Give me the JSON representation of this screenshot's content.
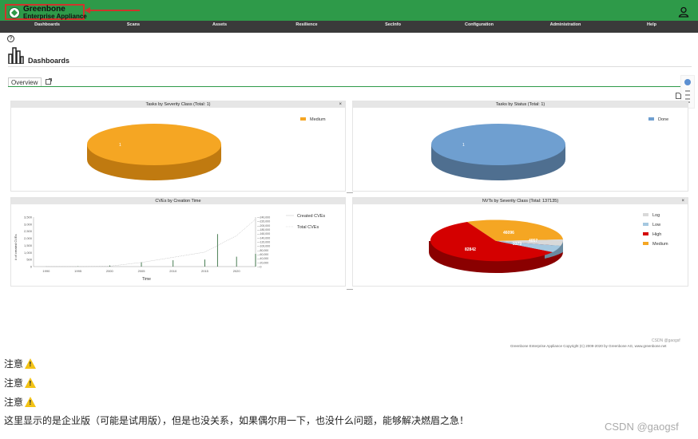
{
  "header": {
    "logo_line1": "Greenbone",
    "logo_line2": "Enterprise Appliance",
    "user_icon": "user-icon",
    "colors": {
      "bar": "#2e9a49",
      "annotation": "#d0342c"
    }
  },
  "nav": {
    "items": [
      "Dashboards",
      "Scans",
      "Assets",
      "Resilience",
      "SecInfo",
      "Configuration",
      "Administration",
      "Help"
    ]
  },
  "page": {
    "title": "Dashboards",
    "tabs": [
      {
        "label": "Overview"
      }
    ]
  },
  "panels": {
    "tasks_severity": {
      "title": "Tasks by Severity Class (Total: 1)",
      "legend": [
        "Medium"
      ],
      "slice_label": "1",
      "color": "#f5a623"
    },
    "tasks_status": {
      "title": "Tasks by Status (Total: 1)",
      "legend": [
        "Done"
      ],
      "slice_label": "1",
      "color": "#6f9fd0"
    },
    "cves": {
      "title": "CVEs by Creation Time",
      "legend": [
        "Created CVEs",
        "Total CVEs"
      ],
      "xlabel": "Time",
      "ylabel": "# of created CVEs",
      "x_ticks": [
        "1990",
        "1995",
        "2000",
        "2005",
        "2010",
        "2015",
        "2020"
      ],
      "y_ticks": [
        "0",
        "500",
        "1,000",
        "1,500",
        "2,000",
        "2,500",
        "3,000",
        "3,500"
      ],
      "y2_ticks": [
        "0",
        "20,000",
        "40,000",
        "60,000",
        "80,000",
        "100,000",
        "120,000",
        "140,000",
        "160,000",
        "180,000",
        "200,000",
        "220,000",
        "240,000"
      ]
    },
    "nvts": {
      "title": "NVTs by Severity Class (Total: 137135)",
      "legend": [
        "Log",
        "Low",
        "High",
        "Medium"
      ],
      "labels": [
        "46096",
        "82842",
        "4057",
        "3379"
      ]
    }
  },
  "footer": {
    "copyright": "Greenbone Enterprise Appliance Copyright (C) 2009-2020 by Greenbone AG, www.greenbone.net",
    "watermark": "CSDN @gaogsf"
  },
  "notes": {
    "items": [
      "注意",
      "注意",
      "注意"
    ],
    "paragraph": "这里显示的是企业版（可能是试用版），但是也没关系，如果偶尔用一下，也没什么问题，能够解决燃眉之急！",
    "watermark": "CSDN @gaogsf"
  },
  "chart_data": [
    {
      "type": "pie",
      "title": "Tasks by Severity Class (Total: 1)",
      "categories": [
        "Medium"
      ],
      "values": [
        1
      ]
    },
    {
      "type": "pie",
      "title": "Tasks by Status (Total: 1)",
      "categories": [
        "Done"
      ],
      "values": [
        1
      ]
    },
    {
      "type": "line",
      "title": "CVEs by Creation Time",
      "xlabel": "Time",
      "ylabel": "# of created CVEs",
      "series": [
        {
          "name": "Created CVEs",
          "x": [
            1990,
            1995,
            2000,
            2005,
            2010,
            2015,
            2017,
            2020,
            2023
          ],
          "values": [
            5,
            20,
            80,
            300,
            450,
            500,
            2300,
            700,
            900
          ]
        },
        {
          "name": "Total CVEs",
          "x": [
            1990,
            1995,
            2000,
            2005,
            2010,
            2015,
            2020,
            2023
          ],
          "values": [
            0,
            200,
            2000,
            20000,
            45000,
            70000,
            150000,
            230000
          ]
        }
      ],
      "ylim": [
        0,
        3500
      ]
    },
    {
      "type": "pie",
      "title": "NVTs by Severity Class (Total: 137135)",
      "categories": [
        "Medium",
        "High",
        "Low",
        "Log"
      ],
      "values": [
        46096,
        82842,
        4057,
        3379
      ]
    }
  ]
}
